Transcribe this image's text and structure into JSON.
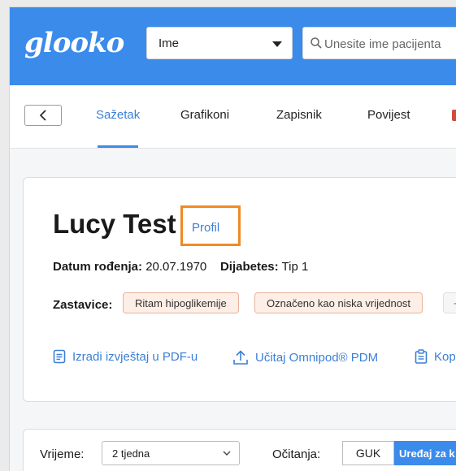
{
  "header": {
    "logo": "glooko",
    "name_select": "Ime",
    "search_placeholder": "Unesite ime pacijenta"
  },
  "tabs": [
    {
      "label": "Sažetak",
      "active": true
    },
    {
      "label": "Grafikoni"
    },
    {
      "label": "Zapisnik"
    },
    {
      "label": "Povijest"
    }
  ],
  "patient": {
    "name": "Lucy Test",
    "profile_link": "Profil",
    "dob_label": "Datum rođenja:",
    "dob_value": "20.07.1970",
    "diabetes_label": "Dijabetes:",
    "diabetes_value": "Tip 1",
    "flags_label": "Zastavice:",
    "flags": [
      "Ritam hipoglikemije",
      "Označeno kao niska vrijednost"
    ],
    "flags_more": "+",
    "actions": [
      "Izradi izvještaj u PDF-u",
      "Učitaj Omnipod® PDM",
      "Kop"
    ]
  },
  "controls": {
    "time_label": "Vrijeme:",
    "time_value": "2 tjedna",
    "readings_label": "Očitanja:",
    "guk_label": "GUK",
    "edit_label": "Uređaj za k"
  },
  "colors": {
    "brand_blue": "#3b8beb",
    "link_blue": "#3b7fd6",
    "highlight_orange": "#f08a24",
    "flag_bg": "#fdeee6"
  }
}
